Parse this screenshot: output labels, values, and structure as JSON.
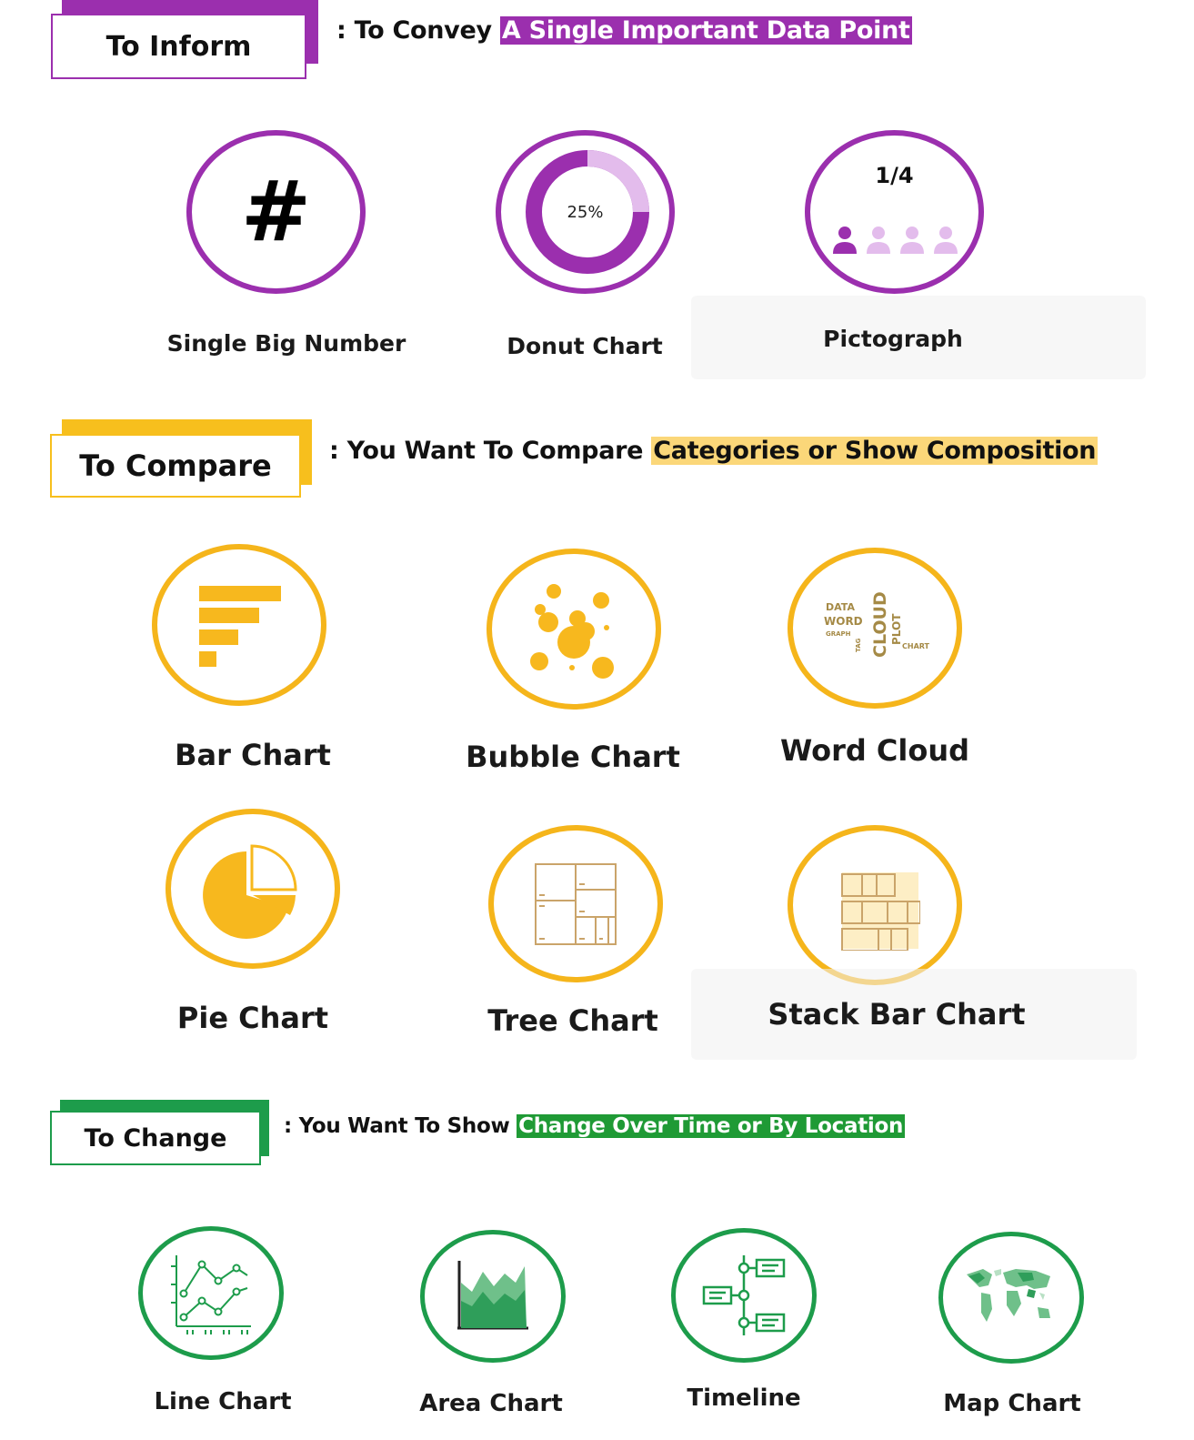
{
  "colors": {
    "inform": "#9b2fae",
    "inform_light": "#d9a8e4",
    "compare": "#f5b51b",
    "compare_highlight": "#fbd779",
    "change": "#1d9c4b",
    "change_highlight": "#1f9a35"
  },
  "sections": {
    "inform": {
      "title": "To Inform",
      "subtitle_prefix": ": To Convey",
      "subtitle_highlight": "A Single Important Data Point",
      "items": [
        {
          "label": "Single Big Number",
          "icon": "hash-icon",
          "text": "#"
        },
        {
          "label": "Donut Chart",
          "icon": "donut-chart-icon",
          "text": "25%",
          "percent": 25
        },
        {
          "label": "Pictograph",
          "icon": "pictograph-icon",
          "text": "1/4",
          "filled": 1,
          "total": 4
        }
      ]
    },
    "compare": {
      "title": "To Compare",
      "subtitle_prefix": ": You Want To Compare",
      "subtitle_highlight": "Categories or Show Composition",
      "items": [
        {
          "label": "Bar Chart",
          "icon": "bar-chart-icon"
        },
        {
          "label": "Bubble Chart",
          "icon": "bubble-chart-icon"
        },
        {
          "label": "Word Cloud",
          "icon": "word-cloud-icon",
          "words": [
            "DATA",
            "WORD",
            "GRAPH",
            "TAG",
            "CLOUD",
            "PLOT",
            "CHART"
          ]
        },
        {
          "label": "Pie Chart",
          "icon": "pie-chart-icon"
        },
        {
          "label": "Tree Chart",
          "icon": "tree-chart-icon"
        },
        {
          "label": "Stack Bar Chart",
          "icon": "stack-bar-chart-icon"
        }
      ]
    },
    "change": {
      "title": "To Change",
      "subtitle_prefix": ": You Want To Show",
      "subtitle_highlight": "Change Over Time or By Location",
      "items": [
        {
          "label": "Line Chart",
          "icon": "line-chart-icon"
        },
        {
          "label": "Area Chart",
          "icon": "area-chart-icon"
        },
        {
          "label": "Timeline",
          "icon": "timeline-icon"
        },
        {
          "label": "Map Chart",
          "icon": "map-chart-icon"
        }
      ]
    }
  }
}
